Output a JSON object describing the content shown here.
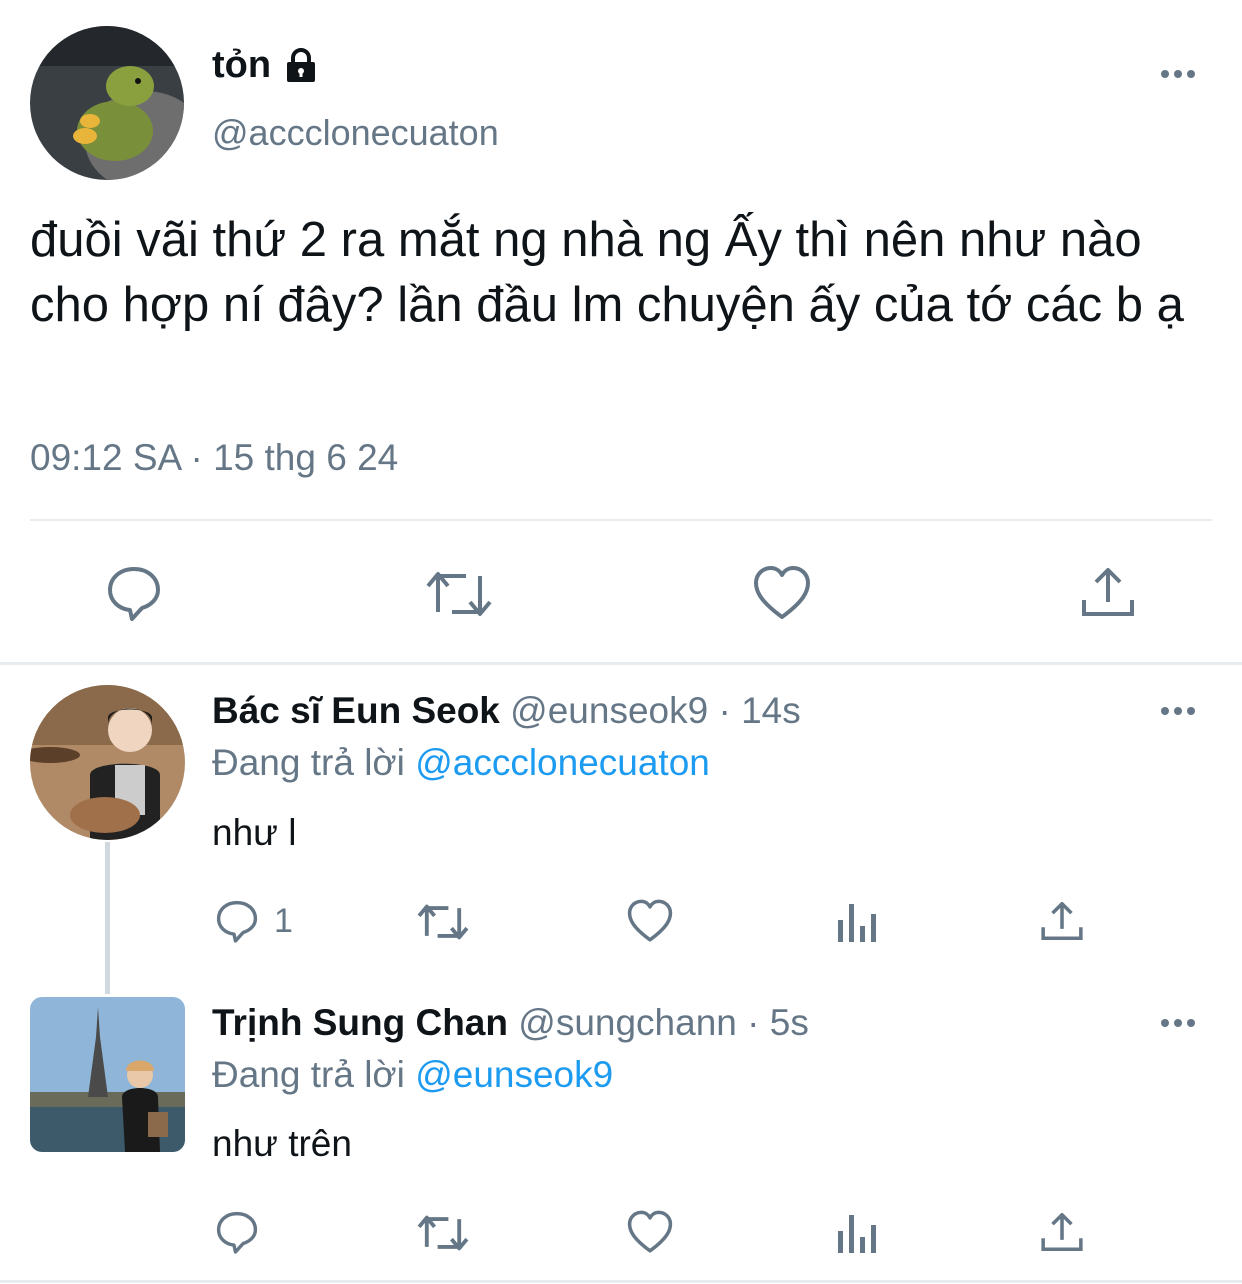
{
  "colors": {
    "text": "#0f1419",
    "secondary": "#657786",
    "accent": "#1d9bf0",
    "divider": "#e6ecf0"
  },
  "main_tweet": {
    "display_name": "tỏn",
    "handle": "@accclonecuaton",
    "text": "đuồi vãi thứ 2 ra mắt ng nhà ng Ấy thì nên như nào cho hợp ní đây? lần đầu lm chuyện ấy của tớ các b ạ",
    "timestamp": "09:12 SA · 15 thg 6 24",
    "avatar_icon": "dinosaur-plush-photo",
    "actions": [
      "reply-icon",
      "retweet-icon",
      "like-icon",
      "share-icon"
    ]
  },
  "replies": [
    {
      "display_name": "Bác sĩ Eun Seok",
      "handle": "@eunseok9",
      "time": "· 14s",
      "replying_label": "Đang trả lời",
      "replying_to": "@accclonecuaton",
      "text": "như l",
      "reply_count": "1",
      "avatar_icon": "person-with-dog-photo"
    },
    {
      "display_name": "Trịnh Sung Chan",
      "handle": "@sungchann",
      "time": "· 5s",
      "replying_label": "Đang trả lời",
      "replying_to": "@eunseok9",
      "text": "như trên",
      "reply_count": "",
      "avatar_icon": "eiffel-tower-photo"
    }
  ]
}
